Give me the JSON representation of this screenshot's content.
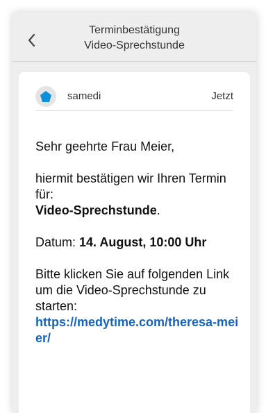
{
  "header": {
    "title_line1": "Terminbestätigung",
    "title_line2": "Video-Sprechstunde",
    "back_icon": "chevron-left-icon"
  },
  "message": {
    "sender": "samedi",
    "time": "Jetzt",
    "avatar_icon": "pentagon-icon",
    "avatar_color": "#0a8fd8",
    "greeting": "Sehr geehrte Frau Meier,",
    "confirm_text": "hiermit bestätigen wir Ihren Termin für:",
    "appointment_type": "Video-Sprechstunde",
    "appointment_suffix": ".",
    "date_label": "Datum: ",
    "date_value": "14. August, 10:00 Uhr",
    "instructions": "Bitte klicken Sie auf folgenden Link um die Video-Sprechstunde zu starten:",
    "link": "https://medytime.com/theresa-meier/",
    "link_color": "#1565c0"
  }
}
